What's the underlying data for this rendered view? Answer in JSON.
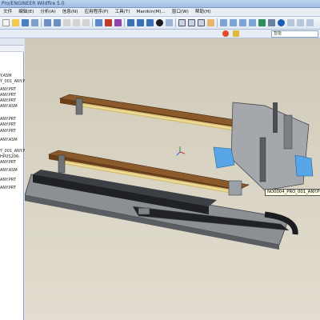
{
  "title": "Pro/ENGINEER Wildfire 5.0",
  "menu": [
    "文件",
    "编辑(E)",
    "分析(A)",
    "信息(N)",
    "应用程序(P)",
    "工具(T)",
    "Manikin(M)...",
    "窗口(W)",
    "帮助(H)"
  ],
  "search_placeholder": "智能",
  "tree": [
    "Y.ASM",
    "Y_001_ANY.PRT",
    "ANY.PRT",
    "ANY.PRT",
    "ANY.PRT",
    "ANY.ASM",
    "ANY.PRT",
    "ANY.PRT",
    "ANY.PRT",
    "ANY.ASM",
    "Y_001_ANY.PRT",
    "HPUS206-",
    "ANY.PRT",
    "ANY.ASM",
    "ANY.PRT",
    "ANY.PRT"
  ],
  "tooltip": "NO0004_PRO_001_ANY.PRT"
}
